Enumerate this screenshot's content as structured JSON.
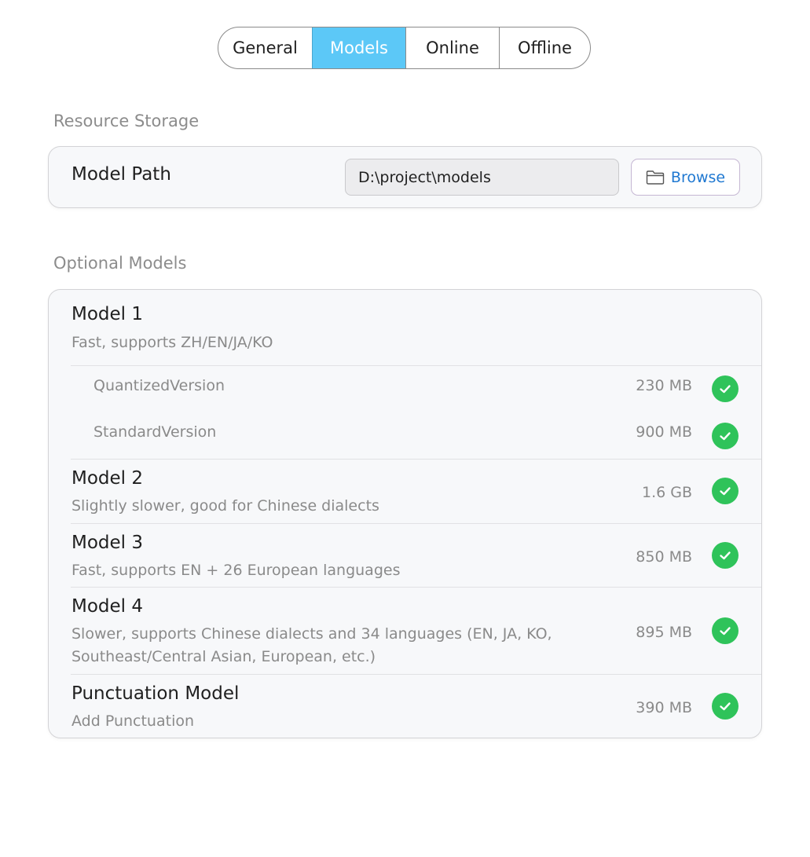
{
  "tabs": [
    {
      "label": "General",
      "active": false
    },
    {
      "label": "Models",
      "active": true
    },
    {
      "label": "Online",
      "active": false
    },
    {
      "label": "Offline",
      "active": false
    }
  ],
  "resource_storage": {
    "title": "Resource Storage",
    "model_path_label": "Model Path",
    "model_path_value": "D:\\project\\models",
    "browse_label": "Browse",
    "browse_icon": "folder-icon"
  },
  "optional_models": {
    "title": "Optional Models",
    "models": [
      {
        "name": "Model 1",
        "description": "Fast, supports ZH/EN/JA/KO",
        "versions": [
          {
            "name": "QuantizedVersion",
            "size": "230 MB",
            "installed": true
          },
          {
            "name": "StandardVersion",
            "size": "900 MB",
            "installed": true
          }
        ]
      },
      {
        "name": "Model 2",
        "description": "Slightly slower, good for Chinese dialects",
        "size": "1.6 GB",
        "installed": true
      },
      {
        "name": "Model 3",
        "description": "Fast, supports EN + 26 European languages",
        "size": "850 MB",
        "installed": true
      },
      {
        "name": "Model 4",
        "description": "Slower, supports Chinese dialects and 34 languages (EN, JA, KO, Southeast/Central Asian, European, etc.)",
        "size": "895 MB",
        "installed": true
      },
      {
        "name": "Punctuation Model",
        "description": "Add Punctuation",
        "size": "390 MB",
        "installed": true
      }
    ]
  },
  "colors": {
    "accent_tab": "#5cc8f7",
    "installed_check": "#2fc35a",
    "browse_text": "#1f78d1"
  }
}
